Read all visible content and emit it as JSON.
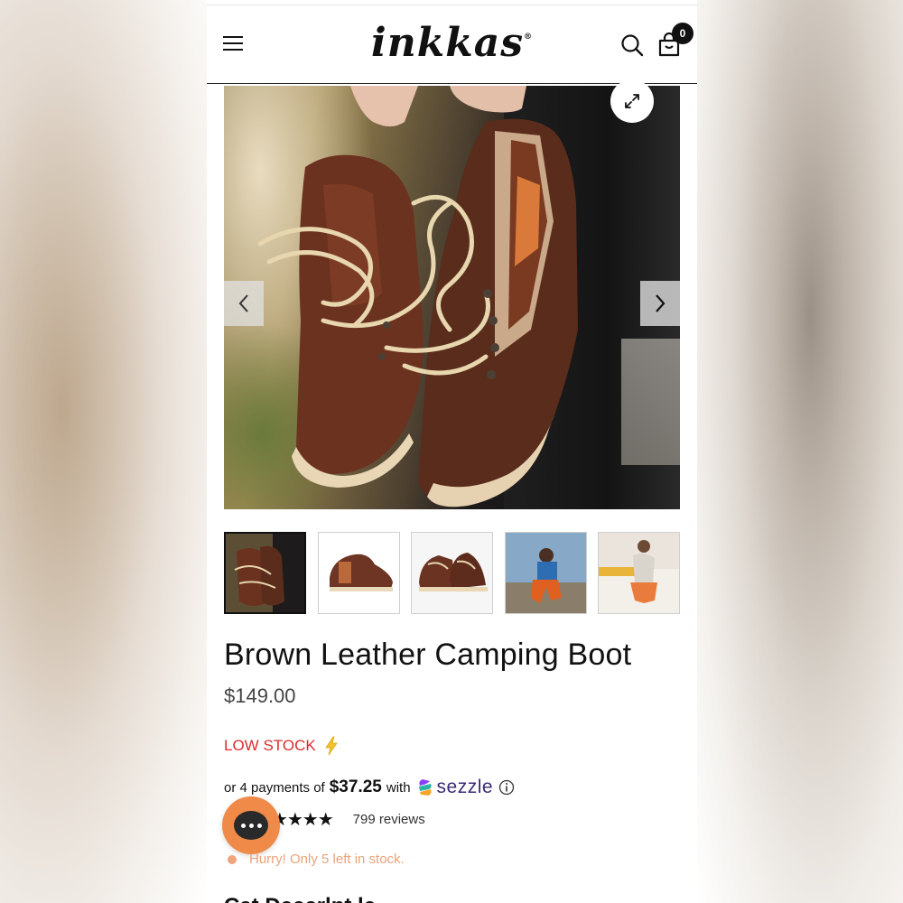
{
  "header": {
    "brand": "inkkas",
    "brand_mark": "®",
    "cart_count": "0"
  },
  "gallery": {
    "images": [
      "boots-held-in-hand",
      "boot-side-view",
      "boots-pair-front",
      "model-seated-outdoors",
      "model-seated-on-bed"
    ],
    "active_index": 0
  },
  "product": {
    "title": "Brown Leather Camping Boot",
    "price": "$149.00",
    "stock_label": "LOW STOCK",
    "installments_prefix": "or 4 payments of",
    "installments_amount": "$37.25",
    "installments_with": "with",
    "payment_provider": "sezzle",
    "review_count": "799 reviews",
    "rating": 5,
    "stock_note": "Hurry! Only 5 left in stock.",
    "next_section_heading": "Cat    Deccrlpt le"
  },
  "colors": {
    "accent_orange": "#f08a48",
    "low_stock_red": "#d92c2c",
    "sezzle_purple": "#3d2a78"
  }
}
